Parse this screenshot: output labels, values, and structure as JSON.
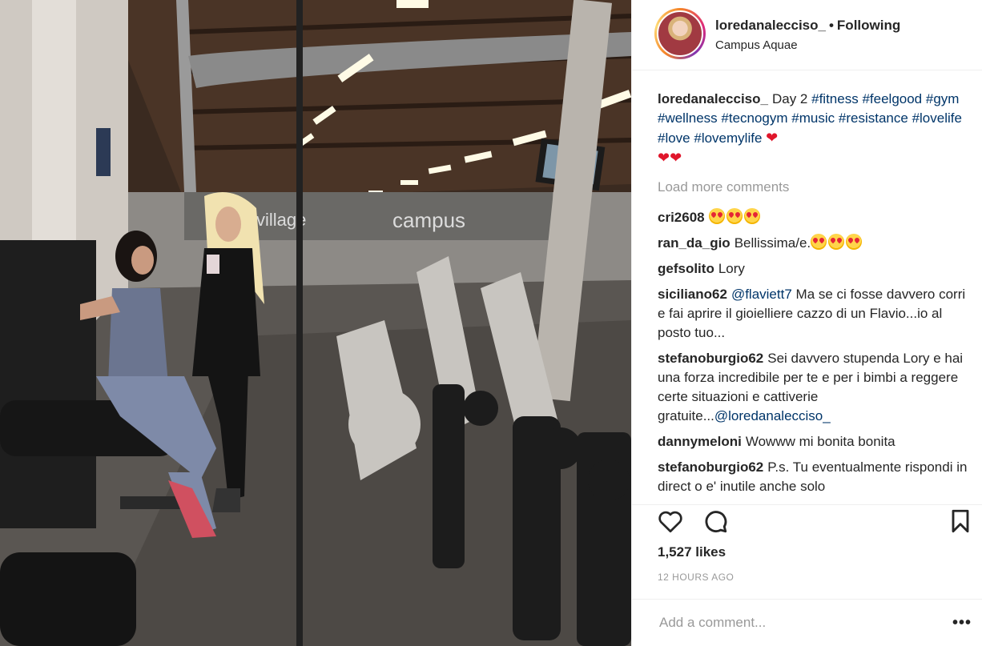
{
  "post": {
    "username": "loredanalecciso_",
    "separator": "•",
    "follow_state": "Following",
    "location": "Campus Aquae",
    "photo_sign_1": "village",
    "photo_sign_2": "campus"
  },
  "caption": {
    "username": "loredanalecciso_",
    "text": "Day 2",
    "tags": [
      "#fitness",
      "#feelgood",
      "#gym",
      "#wellness",
      "#tecnogym",
      "#music",
      "#resistance",
      "#lovelife",
      "#love",
      "#lovemylife"
    ]
  },
  "load_more": "Load more comments",
  "comments": [
    {
      "user": "cri2608",
      "text": ""
    },
    {
      "user": "ran_da_gio",
      "text": "Bellissima/e."
    },
    {
      "user": "gefsolito",
      "text": "Lory"
    },
    {
      "user": "siciliano62",
      "mention": "@flaviett7",
      "text": "Ma se ci fosse davvero corri e fai aprire il gioielliere cazzo di un Flavio...io al posto tuo..."
    },
    {
      "user": "stefanoburgio62",
      "text": "Sei davvero stupenda Lory e hai una forza incredibile per te e per i bimbi a reggere certe situazioni e cattiverie gratuite...",
      "mention": "@loredanalecciso_"
    },
    {
      "user": "dannymeloni",
      "text": "Wowww mi bonita bonita"
    },
    {
      "user": "stefanoburgio62",
      "text": "P.s. Tu eventualmente rispondi in direct o e' inutile anche solo"
    }
  ],
  "icons": {
    "like": "heart-outline-icon",
    "comment": "speech-bubble-icon",
    "save": "bookmark-icon",
    "options": "more-dots-icon"
  },
  "likes": "1,527 likes",
  "time": "12 HOURS AGO",
  "add_comment": {
    "placeholder": "Add a comment..."
  },
  "options_glyph": "•••",
  "colors": {
    "tag": "#003569",
    "muted": "#999999",
    "heart": "#e0162b",
    "text": "#262626"
  }
}
